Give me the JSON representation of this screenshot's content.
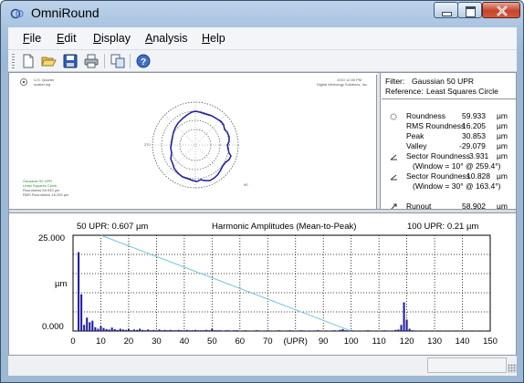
{
  "window": {
    "title": "OmniRound"
  },
  "menu": [
    "File",
    "Edit",
    "Display",
    "Analysis",
    "Help"
  ],
  "menu_mnemonic": [
    "F",
    "E",
    "D",
    "A",
    "H"
  ],
  "toolbar": {
    "buttons": [
      {
        "icon": "new-document-icon"
      },
      {
        "icon": "open-folder-icon"
      },
      {
        "icon": "save-disk-icon"
      },
      {
        "icon": "printer-icon"
      },
      {
        "icon": "copy-icon"
      },
      {
        "icon": "help-icon"
      }
    ]
  },
  "polar": {
    "header_left_line1": "U.S. Quarter",
    "header_left_line2": "scatter.log",
    "header_right_line1": "2010 12:00 PM",
    "header_right_line2": "Digital Metrology Solutions, Inc.",
    "axis_left": "270",
    "axis_right": "90",
    "bottom_left_lines": [
      "Gaussian 50 UPR",
      "Least Squares Circle",
      "Roundness 59.933 µm",
      "RMS Roundness 16.205 µm"
    ]
  },
  "results": {
    "filter_label": "Filter:",
    "filter_value": "Gaussian 50 UPR",
    "reference_label": "Reference:",
    "reference_value": "Least Squares Circle",
    "rows": [
      {
        "label": "Roundness",
        "value": "59.933",
        "unit": "µm",
        "icon": "roundness-icon"
      },
      {
        "label": "RMS Roundness",
        "value": "16.205",
        "unit": "µm",
        "icon": ""
      },
      {
        "label": "Peak",
        "value": "30.853",
        "unit": "µm",
        "icon": ""
      },
      {
        "label": "Valley",
        "value": "-29.079",
        "unit": "µm",
        "icon": ""
      },
      {
        "label": "Sector Roundness",
        "value": "3.931",
        "unit": "µm",
        "icon": "sector-icon"
      },
      {
        "label": "(Window = 10°  @ 259.4°)",
        "value": "",
        "unit": "",
        "icon": ""
      },
      {
        "label": "Sector Roundness",
        "value": "10.828",
        "unit": "µm",
        "icon": "sector-icon"
      },
      {
        "label": "(Window = 30°  @ 163.4°)",
        "value": "",
        "unit": "",
        "icon": ""
      },
      {
        "label": "Runout",
        "value": "58.902",
        "unit": "µm",
        "icon": "runout-icon"
      }
    ]
  },
  "chart_header": {
    "left": "50 UPR:  0.607 µm",
    "center": "Harmonic Amplitudes (Mean-to-Peak)",
    "right": "100 UPR:  0.21 µm"
  },
  "chart_data": {
    "type": "bar",
    "title": "Harmonic Amplitudes (Mean-to-Peak)",
    "xlabel": "(UPR)",
    "ylabel": "µm",
    "xlim": [
      0,
      150
    ],
    "ylim": [
      0,
      25
    ],
    "y_tick_labels": [
      "25.000",
      "µm",
      "0.000"
    ],
    "x_ticks": [
      0,
      10,
      20,
      30,
      40,
      50,
      60,
      70,
      90,
      100,
      110,
      120,
      130,
      140,
      150
    ],
    "x_axis_label_position": 80,
    "colors": {
      "bars": "#1a1a9c",
      "trend_line": "#79c3df",
      "grid": "#000000"
    },
    "harmonics": [
      {
        "upr": 2,
        "amplitude": 20.6
      },
      {
        "upr": 3,
        "amplitude": 9.6
      },
      {
        "upr": 4,
        "amplitude": 1.6
      },
      {
        "upr": 5,
        "amplitude": 3.5
      },
      {
        "upr": 6,
        "amplitude": 2.3
      },
      {
        "upr": 7,
        "amplitude": 2.7
      },
      {
        "upr": 8,
        "amplitude": 1.0
      },
      {
        "upr": 9,
        "amplitude": 0.6
      },
      {
        "upr": 10,
        "amplitude": 1.3
      },
      {
        "upr": 11,
        "amplitude": 0.8
      },
      {
        "upr": 12,
        "amplitude": 0.5
      },
      {
        "upr": 13,
        "amplitude": 0.4
      },
      {
        "upr": 14,
        "amplitude": 0.9
      },
      {
        "upr": 15,
        "amplitude": 0.5
      },
      {
        "upr": 16,
        "amplitude": 0.3
      },
      {
        "upr": 17,
        "amplitude": 0.6
      },
      {
        "upr": 18,
        "amplitude": 0.4
      },
      {
        "upr": 19,
        "amplitude": 0.3
      },
      {
        "upr": 20,
        "amplitude": 0.5
      },
      {
        "upr": 21,
        "amplitude": 0.2
      },
      {
        "upr": 22,
        "amplitude": 0.4
      },
      {
        "upr": 23,
        "amplitude": 0.3
      },
      {
        "upr": 24,
        "amplitude": 0.6
      },
      {
        "upr": 25,
        "amplitude": 0.3
      },
      {
        "upr": 26,
        "amplitude": 0.2
      },
      {
        "upr": 27,
        "amplitude": 0.4
      },
      {
        "upr": 28,
        "amplitude": 0.2
      },
      {
        "upr": 29,
        "amplitude": 0.3
      },
      {
        "upr": 30,
        "amplitude": 0.2
      },
      {
        "upr": 31,
        "amplitude": 0.4
      },
      {
        "upr": 32,
        "amplitude": 0.2
      },
      {
        "upr": 33,
        "amplitude": 0.3
      },
      {
        "upr": 34,
        "amplitude": 0.2
      },
      {
        "upr": 35,
        "amplitude": 0.3
      },
      {
        "upr": 36,
        "amplitude": 0.2
      },
      {
        "upr": 37,
        "amplitude": 0.2
      },
      {
        "upr": 38,
        "amplitude": 0.3
      },
      {
        "upr": 39,
        "amplitude": 0.2
      },
      {
        "upr": 40,
        "amplitude": 0.2
      },
      {
        "upr": 41,
        "amplitude": 0.3
      },
      {
        "upr": 42,
        "amplitude": 0.2
      },
      {
        "upr": 43,
        "amplitude": 0.2
      },
      {
        "upr": 44,
        "amplitude": 0.3
      },
      {
        "upr": 45,
        "amplitude": 0.2
      },
      {
        "upr": 46,
        "amplitude": 0.2
      },
      {
        "upr": 47,
        "amplitude": 0.2
      },
      {
        "upr": 48,
        "amplitude": 0.3
      },
      {
        "upr": 49,
        "amplitude": 0.2
      },
      {
        "upr": 50,
        "amplitude": 0.6
      },
      {
        "upr": 51,
        "amplitude": 0.2
      },
      {
        "upr": 52,
        "amplitude": 0.2
      },
      {
        "upr": 53,
        "amplitude": 0.2
      },
      {
        "upr": 54,
        "amplitude": 0.1
      },
      {
        "upr": 55,
        "amplitude": 0.2
      },
      {
        "upr": 56,
        "amplitude": 0.2
      },
      {
        "upr": 57,
        "amplitude": 0.1
      },
      {
        "upr": 58,
        "amplitude": 0.2
      },
      {
        "upr": 59,
        "amplitude": 0.2
      },
      {
        "upr": 60,
        "amplitude": 0.1
      },
      {
        "upr": 62,
        "amplitude": 0.2
      },
      {
        "upr": 64,
        "amplitude": 0.1
      },
      {
        "upr": 66,
        "amplitude": 0.2
      },
      {
        "upr": 68,
        "amplitude": 0.1
      },
      {
        "upr": 70,
        "amplitude": 0.2
      },
      {
        "upr": 72,
        "amplitude": 0.1
      },
      {
        "upr": 74,
        "amplitude": 0.2
      },
      {
        "upr": 76,
        "amplitude": 0.1
      },
      {
        "upr": 78,
        "amplitude": 0.2
      },
      {
        "upr": 80,
        "amplitude": 0.1
      },
      {
        "upr": 82,
        "amplitude": 0.2
      },
      {
        "upr": 84,
        "amplitude": 0.1
      },
      {
        "upr": 86,
        "amplitude": 0.1
      },
      {
        "upr": 88,
        "amplitude": 0.2
      },
      {
        "upr": 90,
        "amplitude": 0.1
      },
      {
        "upr": 92,
        "amplitude": 0.1
      },
      {
        "upr": 94,
        "amplitude": 0.2
      },
      {
        "upr": 95,
        "amplitude": 0.1
      },
      {
        "upr": 96,
        "amplitude": 0.3
      },
      {
        "upr": 97,
        "amplitude": 0.5
      },
      {
        "upr": 98,
        "amplitude": 0.2
      },
      {
        "upr": 99,
        "amplitude": 0.1
      },
      {
        "upr": 100,
        "amplitude": 0.21
      },
      {
        "upr": 102,
        "amplitude": 0.1
      },
      {
        "upr": 104,
        "amplitude": 0.1
      },
      {
        "upr": 106,
        "amplitude": 0.2
      },
      {
        "upr": 108,
        "amplitude": 0.1
      },
      {
        "upr": 110,
        "amplitude": 0.1
      },
      {
        "upr": 112,
        "amplitude": 0.2
      },
      {
        "upr": 114,
        "amplitude": 0.1
      },
      {
        "upr": 116,
        "amplitude": 0.3
      },
      {
        "upr": 117,
        "amplitude": 0.4
      },
      {
        "upr": 118,
        "amplitude": 1.6
      },
      {
        "upr": 119,
        "amplitude": 7.5
      },
      {
        "upr": 120,
        "amplitude": 3.0
      },
      {
        "upr": 121,
        "amplitude": 0.6
      },
      {
        "upr": 122,
        "amplitude": 0.2
      },
      {
        "upr": 124,
        "amplitude": 0.1
      },
      {
        "upr": 126,
        "amplitude": 0.1
      },
      {
        "upr": 128,
        "amplitude": 0.1
      },
      {
        "upr": 130,
        "amplitude": 0.1
      },
      {
        "upr": 133,
        "amplitude": 0.1
      },
      {
        "upr": 136,
        "amplitude": 0.1
      },
      {
        "upr": 139,
        "amplitude": 0.1
      },
      {
        "upr": 142,
        "amplitude": 0.1
      },
      {
        "upr": 145,
        "amplitude": 0.1
      },
      {
        "upr": 148,
        "amplitude": 0.1
      }
    ],
    "trend_line": [
      {
        "upr": 10,
        "amplitude": 25
      },
      {
        "upr": 100,
        "amplitude": 0
      }
    ]
  },
  "statusbar": {
    "panel_text": ""
  }
}
